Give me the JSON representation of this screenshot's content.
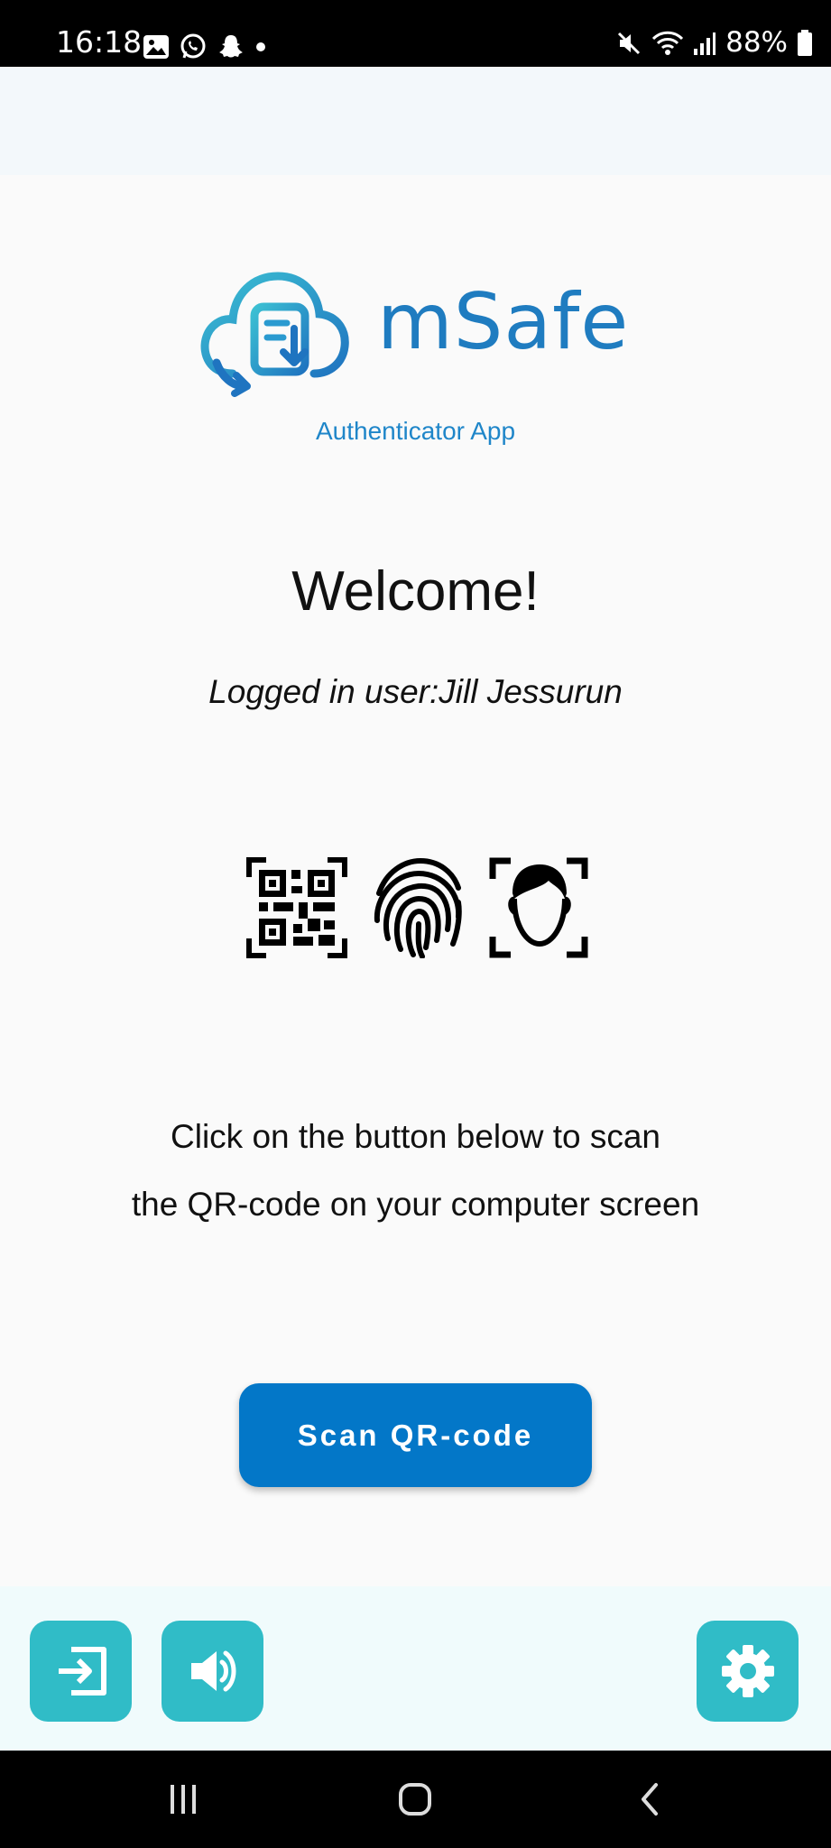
{
  "status_bar": {
    "time": "16:18",
    "battery": "88%",
    "left_icons": [
      "gallery-icon",
      "whatsapp-icon",
      "snapchat-icon",
      "dot-icon"
    ],
    "right_icons": [
      "mute-icon",
      "wifi-icon",
      "signal-icon",
      "battery-icon"
    ]
  },
  "logo": {
    "name": "mSafe",
    "subtitle": "Authenticator App"
  },
  "welcome": {
    "title": "Welcome!",
    "logged_user": "Logged in user:Jill Jessurun"
  },
  "auth_icons": [
    "qr-code-icon",
    "fingerprint-icon",
    "face-scan-icon"
  ],
  "instructions": {
    "line1": "Click on the button below to scan",
    "line2": "the QR-code on your computer screen"
  },
  "scan_button": {
    "label": "Scan QR-code"
  },
  "actions": {
    "left": [
      "logout-icon",
      "speaker-icon"
    ],
    "right": [
      "settings-icon"
    ]
  },
  "colors": {
    "brand_blue": "#1f7cc0",
    "button_blue": "#0377c8",
    "action_teal": "#30bcc7"
  },
  "nav": [
    "recents-icon",
    "home-icon",
    "back-icon"
  ]
}
